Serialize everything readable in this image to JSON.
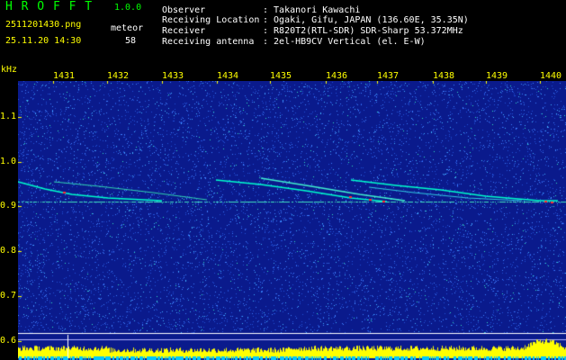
{
  "app": {
    "name": "H R O F F T",
    "version": "1.0.0"
  },
  "file": {
    "filename": "2511201430.png",
    "datetime": "25.11.20 14:30",
    "type_label": "meteor",
    "count": "58"
  },
  "info": {
    "observer_label": "Observer",
    "observer_value": ": Takanori Kawachi",
    "location_label": "Receiving Location",
    "location_value": ": Ogaki, Gifu, JAPAN (136.60E, 35.35N)",
    "receiver_label": "Receiver",
    "receiver_value": ": R820T2(RTL-SDR) SDR-Sharp 53.372MHz",
    "antenna_label": "Receiving antenna",
    "antenna_value": ": 2el-HB9CV Vertical (el. E-W)"
  },
  "axis": {
    "y_unit": "kHz",
    "y_ticks": [
      "1.1",
      "1.0",
      "0.9",
      "0.8",
      "0.7",
      "0.6"
    ],
    "x_ticks": [
      "1431",
      "1432",
      "1433",
      "1434",
      "1435",
      "1436",
      "1437",
      "1438",
      "1439",
      "1440"
    ]
  },
  "colors": {
    "background": "#000000",
    "spectrogram_bg": "#0a1a8c",
    "noise": "#3f7fff",
    "trace": "#00ffcc",
    "hot": "#ff3030",
    "axis_text": "#ffff00",
    "header_text": "#00ff00",
    "spectrum": "#ffff00",
    "baseline": "#00c8ff"
  }
}
